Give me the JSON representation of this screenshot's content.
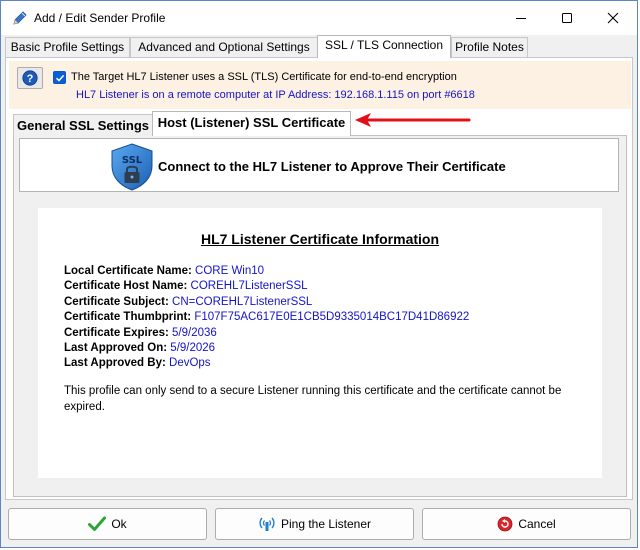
{
  "window": {
    "title": "Add / Edit Sender Profile"
  },
  "tabs": [
    {
      "label": "Basic Profile Settings"
    },
    {
      "label": "Advanced and Optional Settings"
    },
    {
      "label": "SSL / TLS Connection"
    },
    {
      "label": "Profile Notes"
    }
  ],
  "ssl": {
    "use_ssl_label": "The Target HL7 Listener uses a SSL (TLS) Certificate for end-to-end encryption",
    "remote_info": "HL7 Listener is on a remote computer at IP Address: 192.168.1.115 on port #6618",
    "use_ssl_checked": true
  },
  "subtabs": [
    {
      "label": "General SSL Settings"
    },
    {
      "label": "Host (Listener) SSL Certificate"
    }
  ],
  "connect": {
    "label": "Connect to the HL7 Listener to Approve Their Certificate",
    "icon_text": "SSL"
  },
  "cert": {
    "title": "HL7 Listener Certificate Information",
    "rows": [
      {
        "key": "Local Certificate Name:",
        "value": "CORE Win10"
      },
      {
        "key": "Certificate Host Name:",
        "value": "COREHL7ListenerSSL"
      },
      {
        "key": "Certificate Subject:",
        "value": "CN=COREHL7ListenerSSL"
      },
      {
        "key": "Certificate Thumbprint:",
        "value": "F107F75AC617E0E1CB5D9335014BC17D41D86922"
      },
      {
        "key": "Certificate Expires:",
        "value": "5/9/2036"
      },
      {
        "key": "Last Approved On:",
        "value": "5/9/2026"
      },
      {
        "key": "Last Approved By:",
        "value": "DevOps"
      }
    ],
    "note": "This profile can only send to a secure Listener running this certificate and the certificate cannot be expired."
  },
  "buttons": {
    "ok": "Ok",
    "ping": "Ping the Listener",
    "cancel": "Cancel"
  },
  "colors": {
    "link_blue": "#1414c8",
    "header_bg": "#fdf1e3",
    "arrow_red": "#e0101a",
    "checkbox_blue": "#0b5ed7"
  }
}
